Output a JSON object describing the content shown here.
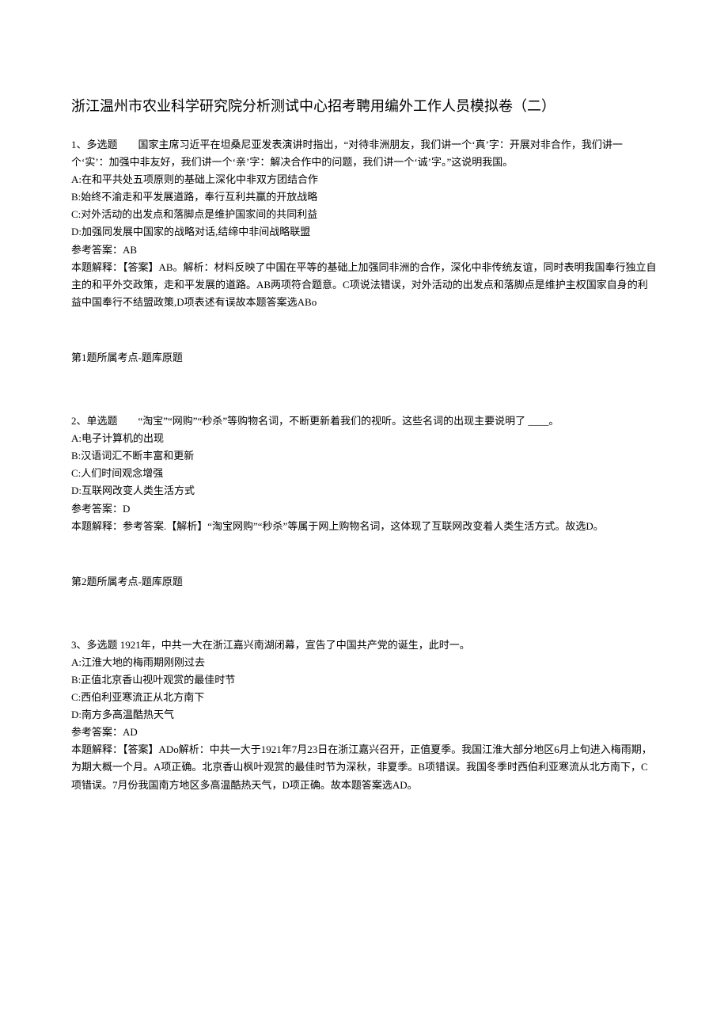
{
  "title": "浙江温州市农业科学研究院分析测试中心招考聘用编外工作人员模拟卷（二）",
  "questions": [
    {
      "header": "1、多选题　　国家主席习近平在坦桑尼亚发表演讲时指出，“对待非洲朋友，我们讲一个‘真’字：开展对非合作，我们讲一个‘实’：加强中非友好，我们讲一个‘亲’字：解决合作中的问题，我们讲一个‘诚’字。”这说明我国。",
      "options": [
        "A:在和平共处五项原则的基础上深化中非双方团结合作",
        "B:始终不渝走和平发展道路，奉行互利共赢的开放战略",
        "C:对外活动的出发点和落脚点是维护国家间的共同利益",
        "D:加强同发展中国家的战略对话,结缔中非间战略联盟"
      ],
      "answer_label": "参考答案：AB",
      "explanation": "本题解释：【答案】AB。解析：材料反映了中国在平等的基础上加强同非洲的合作，深化中非传统友谊，同时表明我国奉行独立自主的和平外交政策，走和平发展的道路。AB两项符合题意。C项说法错误，对外活动的出发点和落脚点是维护主权国家自身的利益中国奉行不结盟政策,D项表述有误故本题答案选ABo",
      "source": "第1题所属考点-题库原题"
    },
    {
      "header": "2、单选题　　“淘宝”“网购”“秒杀”等购物名词，不断更新着我们的视听。这些名词的出现主要说明了 ____。",
      "options": [
        "A:电子计算机的出现",
        "B:汉语词汇不断丰富和更新",
        "C:人们时间观念增强",
        "D:互联网改变人类生活方式"
      ],
      "answer_label": "参考答案：D",
      "explanation": "本题解释：参考答案.【解析】“淘宝网购”“秒杀”等属于网上购物名词，这体现了互联网改变着人类生活方式。故选D。",
      "source": "第2题所属考点-题库原题"
    },
    {
      "header": "3、多选题 1921年，中共一大在浙江嘉兴南湖闭幕，宣告了中国共产党的诞生，此时一。",
      "options": [
        "A:江淮大地的梅雨期刚刚过去",
        "B:正值北京香山视叶观赏的最佳时节",
        "C:西伯利亚寒流正从北方南下",
        "D:南方多高温酷热天气"
      ],
      "answer_label": "参考答案：AD",
      "explanation": "本题解释：【答案】ADo解析：中共一大于1921年7月23日在浙江嘉兴召开，正值夏季。我国江淮大部分地区6月上旬进入梅雨期，为期大概一个月。A项正确。北京香山枫叶观赏的最佳时节为深秋，非夏季。B项错误。我国冬季时西伯利亚寒流从北方南下，C项错误。7月份我国南方地区多高温酷热天气，D项正确。故本题答案选AD。",
      "source": ""
    }
  ]
}
